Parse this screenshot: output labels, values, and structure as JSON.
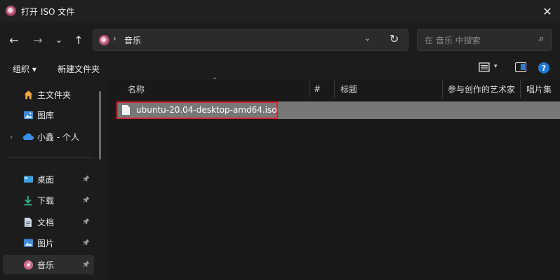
{
  "window": {
    "title": "打开 ISO 文件",
    "close_glyph": "✕"
  },
  "nav": {
    "back_glyph": "←",
    "forward_glyph": "→",
    "recent_glyph": "⌄",
    "up_glyph": "↑",
    "address": {
      "chevron": "›",
      "location": "音乐",
      "dropdown_glyph": "⌄",
      "refresh_glyph": "↻"
    },
    "search": {
      "placeholder": "在 音乐 中搜索",
      "icon_glyph": "⌕"
    }
  },
  "toolbar": {
    "organize_label": "组织 ▾",
    "new_folder_label": "新建文件夹",
    "view_dropdown_glyph": "▾",
    "help_glyph": "?"
  },
  "sidebar": {
    "items": [
      {
        "label": "主文件夹",
        "icon": "home-icon"
      },
      {
        "label": "图库",
        "icon": "gallery-icon"
      },
      {
        "label": "小鑫 - 个人",
        "icon": "onedrive-cloud-icon",
        "expand_glyph": "›"
      },
      {
        "label": "桌面",
        "icon": "desktop-icon",
        "pinned": true
      },
      {
        "label": "下载",
        "icon": "download-icon",
        "pinned": true
      },
      {
        "label": "文档",
        "icon": "document-icon",
        "pinned": true
      },
      {
        "label": "图片",
        "icon": "pictures-icon",
        "pinned": true
      },
      {
        "label": "音乐",
        "icon": "music-icon",
        "pinned": true,
        "selected": true
      }
    ],
    "pin_glyph": "📌"
  },
  "columns": [
    {
      "label": "名称"
    },
    {
      "label": "#"
    },
    {
      "label": "标题"
    },
    {
      "label": "参与创作的艺术家"
    },
    {
      "label": "唱片集"
    }
  ],
  "sort_glyph": "⌃",
  "files": [
    {
      "name": "ubuntu-20.04-desktop-amd64.iso",
      "highlighted": true
    }
  ],
  "colors": {
    "accent": "#1f78d6",
    "highlight_border": "#d8262b",
    "selected_row": "#777777"
  }
}
